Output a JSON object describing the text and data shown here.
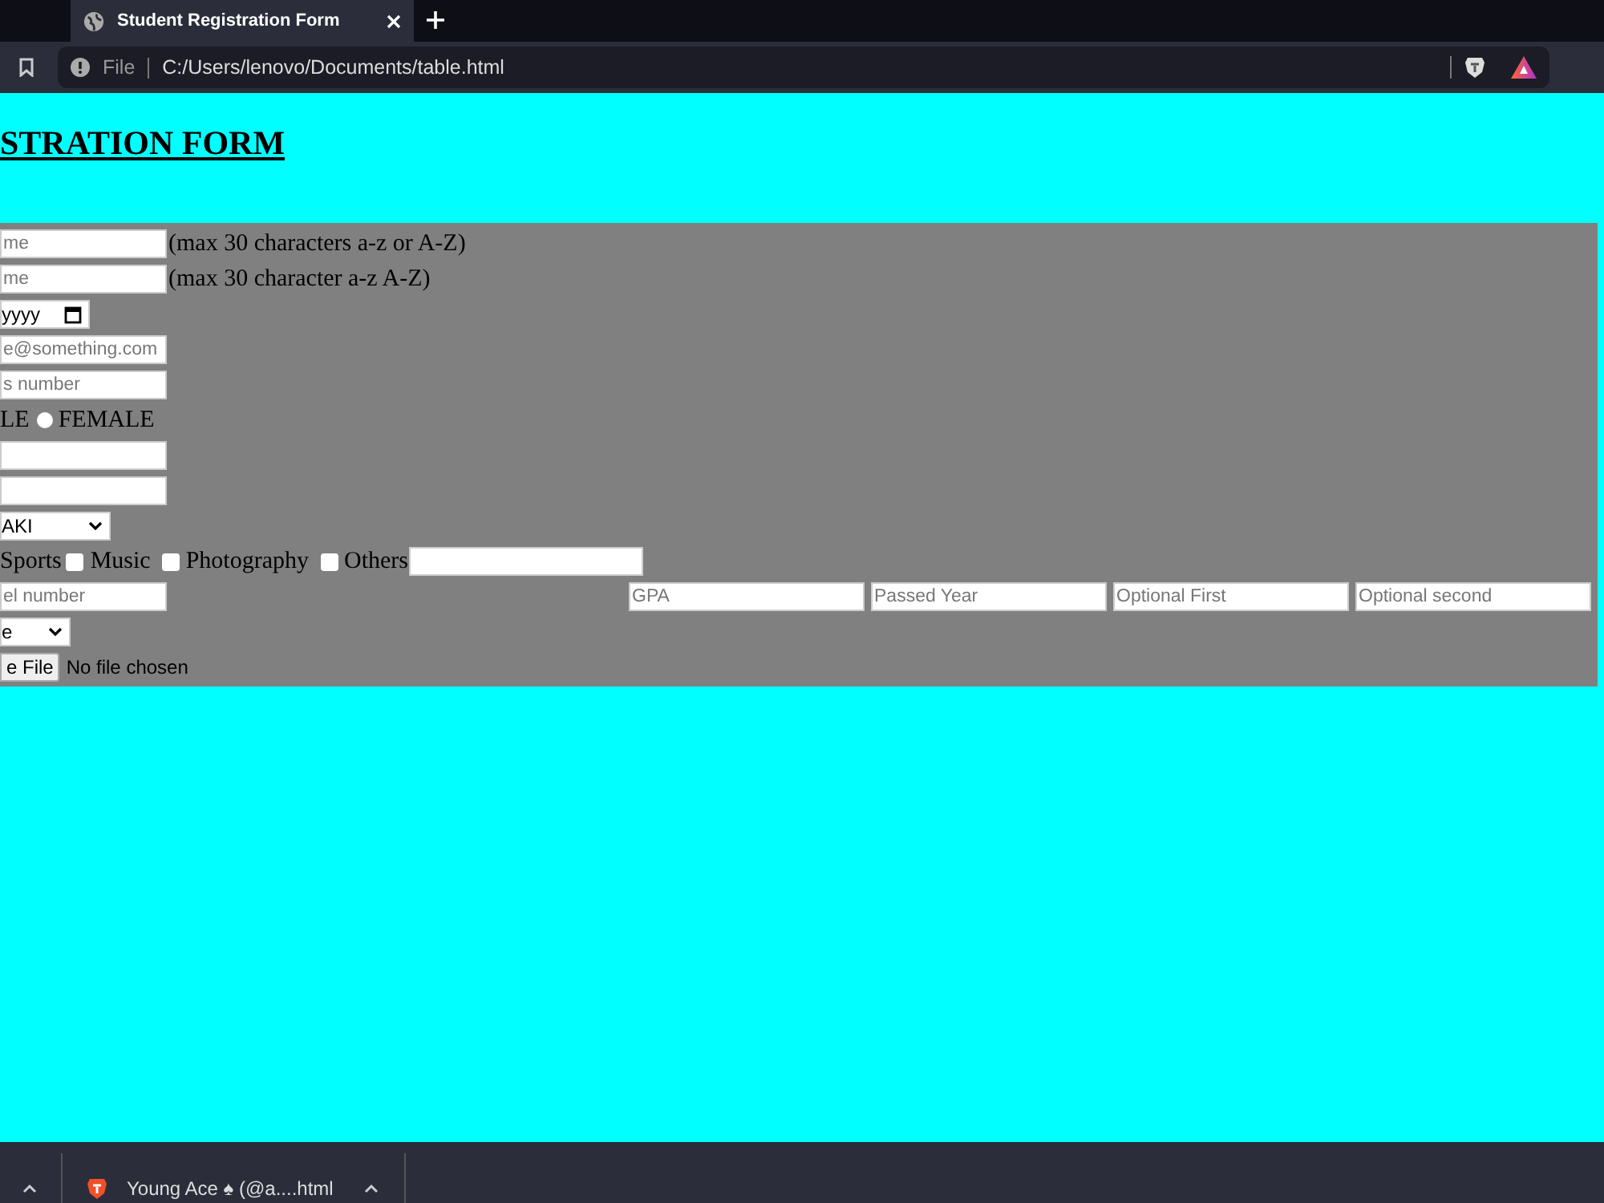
{
  "browser": {
    "tab_title": "Student Registration Form",
    "address_scheme": "File",
    "address": "C:/Users/lenovo/Documents/table.html"
  },
  "page": {
    "heading": "STRATION FORM",
    "form_rows": [
      {
        "kind": "text",
        "placeholder": "me",
        "note": "(max 30 characters a-z or A-Z)"
      },
      {
        "kind": "text",
        "placeholder": "me",
        "note": "(max 30 character a-z A-Z)"
      },
      {
        "kind": "date",
        "value": "yyyy"
      },
      {
        "kind": "text",
        "placeholder": "e@something.com"
      },
      {
        "kind": "text",
        "placeholder": "s number"
      },
      {
        "kind": "radios",
        "leading": "LE",
        "options": [
          {
            "label": "FEMALE",
            "selected": false
          }
        ]
      },
      {
        "kind": "text"
      },
      {
        "kind": "text"
      },
      {
        "kind": "select",
        "value": "AKI"
      },
      {
        "kind": "checks",
        "leading": "Sports",
        "options": [
          {
            "label": "Music",
            "checked": false
          },
          {
            "label": "Photography",
            "checked": false
          },
          {
            "label": "Others",
            "checked": false
          }
        ]
      },
      {
        "kind": "text",
        "placeholder": "el number",
        "more": [
          {
            "placeholder": "GPA"
          },
          {
            "placeholder": "Passed Year"
          },
          {
            "placeholder": "Optional First"
          },
          {
            "placeholder": "Optional second"
          }
        ]
      },
      {
        "kind": "select",
        "value": "e"
      },
      {
        "kind": "file",
        "button": "e File",
        "status": "No file chosen"
      }
    ]
  },
  "taskbar": {
    "download": "Young Ace ♠ (@a....html"
  }
}
